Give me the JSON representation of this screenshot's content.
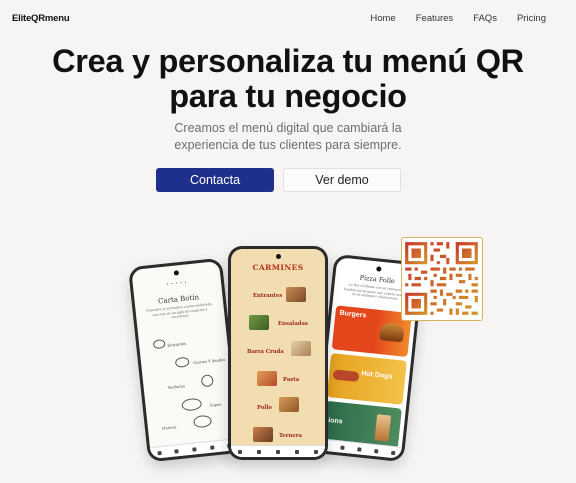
{
  "nav": {
    "brand": "EliteQRmenu",
    "links": [
      "Home",
      "Features",
      "FAQs",
      "Pricing"
    ]
  },
  "hero": {
    "title_line1": "Crea y personaliza tu menú QR",
    "title_line2": "para tu negocio",
    "subtitle_line1": "Creamos el menú digital que cambiará la",
    "subtitle_line2": "experiencia de tus clientes para siempre.",
    "primary_button": "Contacta",
    "secondary_button": "Ver demo"
  },
  "phones": {
    "left": {
      "title": "Carta Botín",
      "description": "Descubre la verdadera cocina madrileña, con más de un siglo de tradición y excelencia.",
      "items": [
        "Entrantes",
        "Carnes Y Asados",
        "Verduras",
        "Sopas",
        "Huevos"
      ]
    },
    "middle": {
      "logo": "CARMINES",
      "items": [
        "Entrantes",
        "Ensaladas",
        "Barra Cruda",
        "Pasta",
        "Pollo",
        "Ternera"
      ]
    },
    "right": {
      "title": "Pizza Folle",
      "description": "Le Bar d'Alfonso est un restaurant familial qui propose une cuisine maison et un ambiance chaleureuse.",
      "cards": [
        "Burgers",
        "Hot Dogs",
        "ions"
      ]
    }
  },
  "colors": {
    "primary_button": "#1f2f8c",
    "background": "#f6f5f3",
    "qr_border": "#d6b458",
    "carmines_red": "#b8301b"
  }
}
